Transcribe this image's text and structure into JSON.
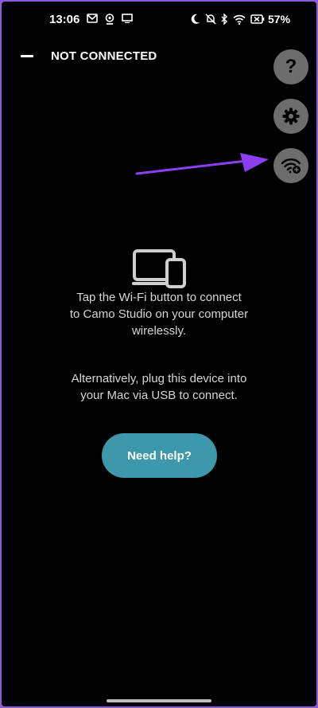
{
  "status_bar": {
    "time": "13:06",
    "battery_percent": "57%",
    "left_icons": [
      "gmail-icon",
      "webcam-icon",
      "cast-icon"
    ],
    "right_icons": [
      "moon-icon",
      "bell-off-icon",
      "bluetooth-icon",
      "wifi-icon",
      "battery-icon"
    ]
  },
  "header": {
    "title": "NOT CONNECTED",
    "menu_icon": "minus-icon"
  },
  "fabs": {
    "help": "?",
    "settings_icon": "gear-icon",
    "wifi_icon": "wifi-connect-icon"
  },
  "content": {
    "device_icon": "devices-icon",
    "line1": "Tap the Wi-Fi button to connect",
    "line2": "to Camo Studio on your computer",
    "line3": "wirelessly.",
    "line4": "Alternatively, plug this device into",
    "line5": "your Mac via USB to connect.",
    "help_button": "Need help?"
  },
  "colors": {
    "accent_button": "#3e98ab",
    "fab_bg": "#6d6d6d",
    "annotation_arrow": "#8a3ff0"
  }
}
